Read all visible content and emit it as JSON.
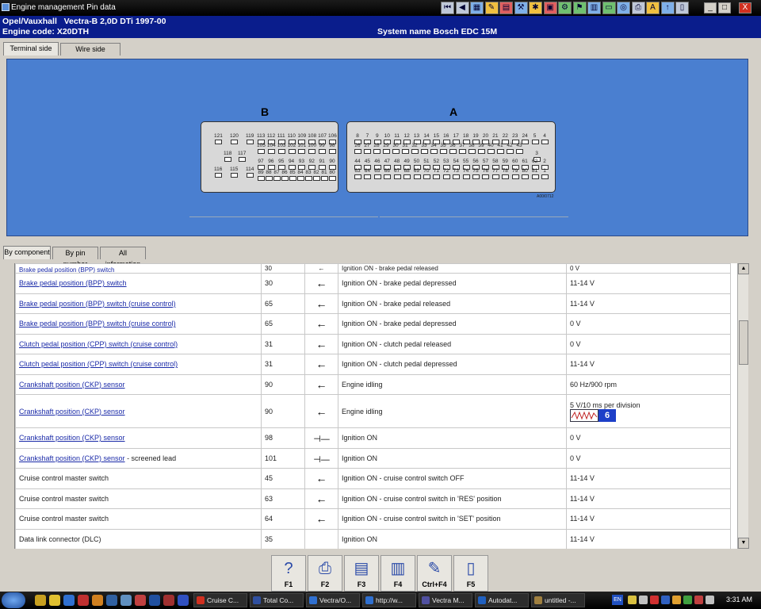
{
  "window": {
    "title": "Engine management Pin data"
  },
  "toolbar": {
    "icons": [
      "first-icon",
      "back-icon",
      "calc-icon",
      "paint-icon",
      "book-icon",
      "tools-icon",
      "lamp-icon",
      "car-icon",
      "gear-icon",
      "flag-icon",
      "clipboard-icon",
      "monitor-icon",
      "web-icon",
      "print-icon",
      "font-icon",
      "arrow-up-icon",
      "page-icon"
    ],
    "minimize": "_",
    "maximize": "□",
    "close": "X"
  },
  "header": {
    "vehicle": "Opel/Vauxhall   Vectra-B 2,0D DTi 1997-00",
    "engine_code": "Engine code: X20DTH",
    "system_name": "System name Bosch EDC 15M",
    "watermark": "ClubOpel.com"
  },
  "tabs_top": {
    "terminal_side": "Terminal side",
    "wire_side": "Wire side"
  },
  "diagram": {
    "connector_b": "B",
    "connector_a": "A",
    "code": "A00/0712",
    "b_rows": [
      [
        "121",
        "120",
        "119",
        "113",
        "112",
        "111",
        "110",
        "109",
        "108",
        "107",
        "106"
      ],
      [
        "118",
        "117",
        "105",
        "104",
        "103",
        "102",
        "101",
        "100",
        "99",
        "98"
      ],
      [
        "116",
        "115",
        "114",
        "97",
        "96",
        "95",
        "94",
        "93",
        "92",
        "91",
        "90",
        "89",
        "88",
        "87",
        "86",
        "85",
        "84",
        "83",
        "82",
        "81",
        "80"
      ]
    ],
    "a_rows": [
      [
        "8",
        "7",
        "9",
        "10",
        "11",
        "12",
        "13",
        "14",
        "15",
        "16",
        "17",
        "18",
        "19",
        "20",
        "21",
        "22",
        "23",
        "24",
        "5",
        "4"
      ],
      [
        "26",
        "27",
        "28",
        "29",
        "30",
        "31",
        "32",
        "33",
        "34",
        "35",
        "36",
        "37",
        "38",
        "39",
        "40",
        "41",
        "42",
        "43",
        "3"
      ],
      [
        "44",
        "45",
        "46",
        "47",
        "48",
        "49",
        "50",
        "51",
        "52",
        "53",
        "54",
        "55",
        "56",
        "57",
        "58",
        "59",
        "60",
        "61",
        "62",
        "2"
      ],
      [
        "63",
        "64",
        "65",
        "66",
        "67",
        "68",
        "69",
        "70",
        "71",
        "72",
        "73",
        "74",
        "75",
        "76",
        "77",
        "78",
        "79",
        "80",
        "81",
        "1"
      ]
    ]
  },
  "tabs_mid": {
    "by_component": "By component",
    "by_pin_number": "By pin number",
    "all_information": "All information"
  },
  "table": {
    "partial_row": {
      "component": "Brake pedal position (BPP) switch",
      "pin": "30",
      "condition": "Ignition ON - brake pedal released",
      "value": "0 V"
    },
    "rows": [
      {
        "component": "Brake pedal position (BPP) switch",
        "suffix": "",
        "pin": "30",
        "arrow": "←",
        "condition": "Ignition ON - brake pedal depressed",
        "value": "11-14 V"
      },
      {
        "component": "Brake pedal position (BPP) switch (cruise control)",
        "suffix": "",
        "pin": "65",
        "arrow": "←",
        "condition": "Ignition ON - brake pedal released",
        "value": "11-14 V"
      },
      {
        "component": "Brake pedal position (BPP) switch (cruise control)",
        "suffix": "",
        "pin": "65",
        "arrow": "←",
        "condition": "Ignition ON - brake pedal depressed",
        "value": "0 V"
      },
      {
        "component": "Clutch pedal position (CPP) switch (cruise control)",
        "suffix": "",
        "pin": "31",
        "arrow": "←",
        "condition": "Ignition ON - clutch pedal released",
        "value": "0 V"
      },
      {
        "component": "Clutch pedal position (CPP) switch (cruise control)",
        "suffix": "",
        "pin": "31",
        "arrow": "←",
        "condition": "Ignition ON - clutch pedal depressed",
        "value": "11-14 V"
      },
      {
        "component": "Crankshaft position (CKP) sensor",
        "suffix": "",
        "pin": "90",
        "arrow": "←",
        "condition": "Engine idling",
        "value": "60 Hz/900 rpm"
      },
      {
        "component": "Crankshaft position (CKP) sensor",
        "suffix": "",
        "pin": "90",
        "arrow": "←",
        "condition": "Engine idling",
        "value": "5 V/10 ms per division",
        "scope_number": "6"
      },
      {
        "component": "Crankshaft position (CKP) sensor",
        "suffix": "",
        "pin": "98",
        "arrow": "⊣—",
        "condition": "Ignition ON",
        "value": "0 V"
      },
      {
        "component": "Crankshaft position (CKP) sensor",
        "suffix": " - screened lead",
        "pin": "101",
        "arrow": "⊣—",
        "condition": "Ignition ON",
        "value": "0 V"
      },
      {
        "component": "Cruise control master switch",
        "suffix": "",
        "pin": "45",
        "arrow": "←",
        "condition": "Ignition ON - cruise control switch OFF",
        "value": "11-14 V",
        "plain": true
      },
      {
        "component": "Cruise control master switch",
        "suffix": "",
        "pin": "63",
        "arrow": "←",
        "condition": "Ignition ON - cruise control switch in 'RES' position",
        "value": "11-14 V",
        "plain": true
      },
      {
        "component": "Cruise control master switch",
        "suffix": "",
        "pin": "64",
        "arrow": "←",
        "condition": "Ignition ON - cruise control switch in 'SET' position",
        "value": "11-14 V",
        "plain": true
      },
      {
        "component": "Data link connector (DLC)",
        "suffix": "",
        "pin": "35",
        "arrow": "",
        "condition": "Ignition ON",
        "value": "11-14 V",
        "plain": true
      }
    ]
  },
  "fkeys": [
    {
      "label": "F1",
      "icon": "help-icon"
    },
    {
      "label": "F2",
      "icon": "print-icon"
    },
    {
      "label": "F3",
      "icon": "print-preview-icon"
    },
    {
      "label": "F4",
      "icon": "print-all-icon"
    },
    {
      "label": "Ctrl+F4",
      "icon": "clipboard-icon"
    },
    {
      "label": "F5",
      "icon": "book-icon"
    }
  ],
  "taskbar": {
    "tasks": [
      "Cruise C...",
      "Total Co...",
      "Vectra/O...",
      "http://w...",
      "Vectra M...",
      "Autodat...",
      "untitled -..."
    ],
    "language": "EN",
    "clock": "3:31 AM"
  }
}
